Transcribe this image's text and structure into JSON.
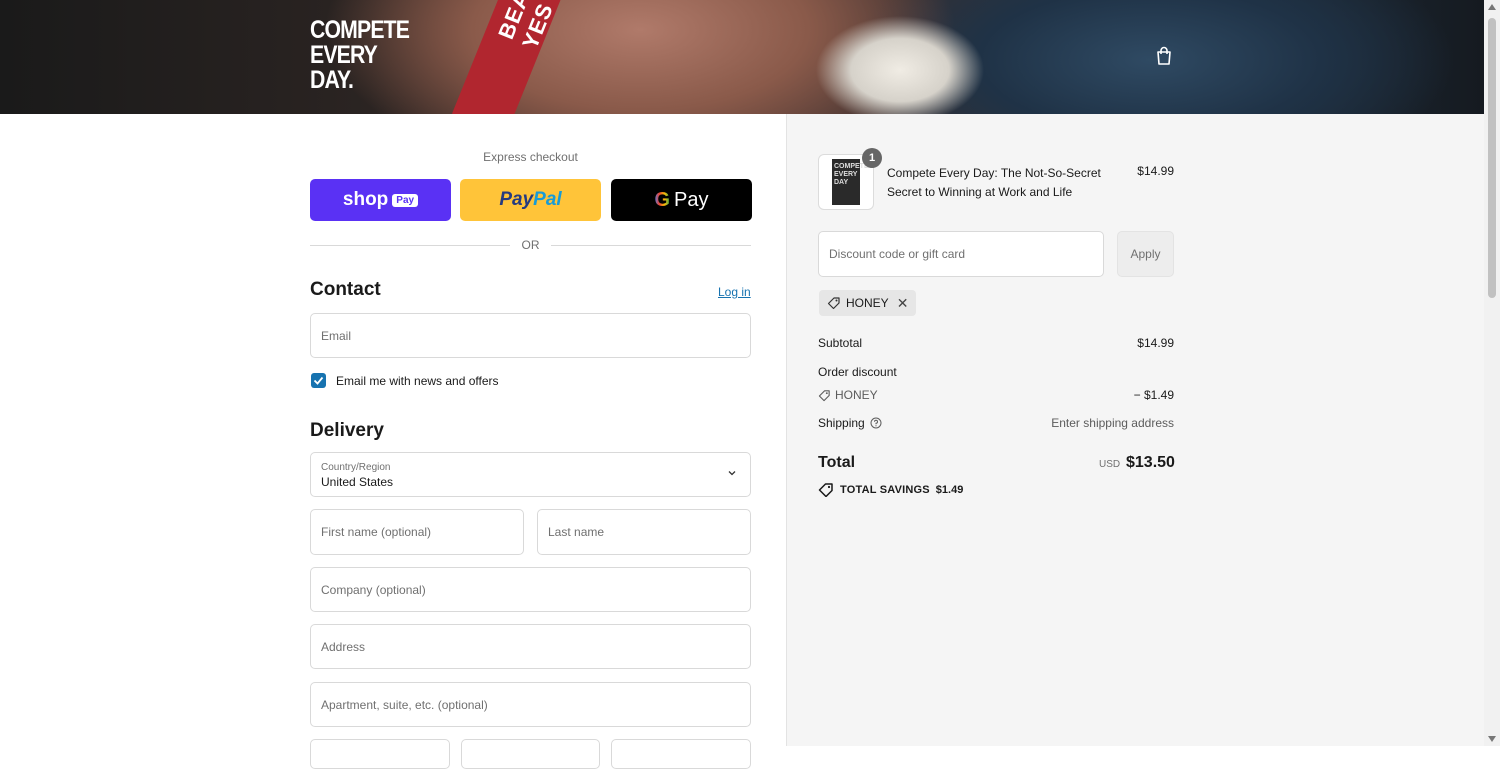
{
  "brand": {
    "logo_lines": [
      "COMPETE",
      "EVERY",
      "DAY."
    ]
  },
  "hero": {
    "strap_text": "BEAT YES"
  },
  "express": {
    "title": "Express checkout",
    "shop_pay": {
      "label": "shop",
      "badge": "Pay"
    },
    "paypal": {
      "part1": "Pay",
      "part2": "Pal"
    },
    "gpay": {
      "g": "G",
      "label": "Pay"
    },
    "or": "OR"
  },
  "contact": {
    "heading": "Contact",
    "login": "Log in",
    "email_placeholder": "Email",
    "newsletter_label": "Email me with news and offers",
    "newsletter_checked": true
  },
  "delivery": {
    "heading": "Delivery",
    "country_label": "Country/Region",
    "country_value": "United States",
    "first_name_placeholder": "First name (optional)",
    "last_name_placeholder": "Last name",
    "company_placeholder": "Company (optional)",
    "address_placeholder": "Address",
    "apartment_placeholder": "Apartment, suite, etc. (optional)"
  },
  "order": {
    "item": {
      "quantity": "1",
      "title": "Compete Every Day: The Not-So-Secret Secret to Winning at Work and Life",
      "price": "$14.99",
      "cover_text": "COMPETE EVERY DAY"
    },
    "discount_placeholder": "Discount code or gift card",
    "apply_label": "Apply",
    "applied_code": "HONEY",
    "subtotal_label": "Subtotal",
    "subtotal_value": "$14.99",
    "order_discount_label": "Order discount",
    "discount_code": "HONEY",
    "discount_value": "− $1.49",
    "shipping_label": "Shipping",
    "shipping_value": "Enter shipping address",
    "total_label": "Total",
    "currency": "USD",
    "total_value": "$13.50",
    "savings_label": "TOTAL SAVINGS",
    "savings_value": "$1.49"
  },
  "colors": {
    "accent": "#1773b0",
    "shop_pay": "#5a31f4",
    "paypal": "#ffc439",
    "gpay": "#000000",
    "summary_bg": "#f5f5f5"
  }
}
